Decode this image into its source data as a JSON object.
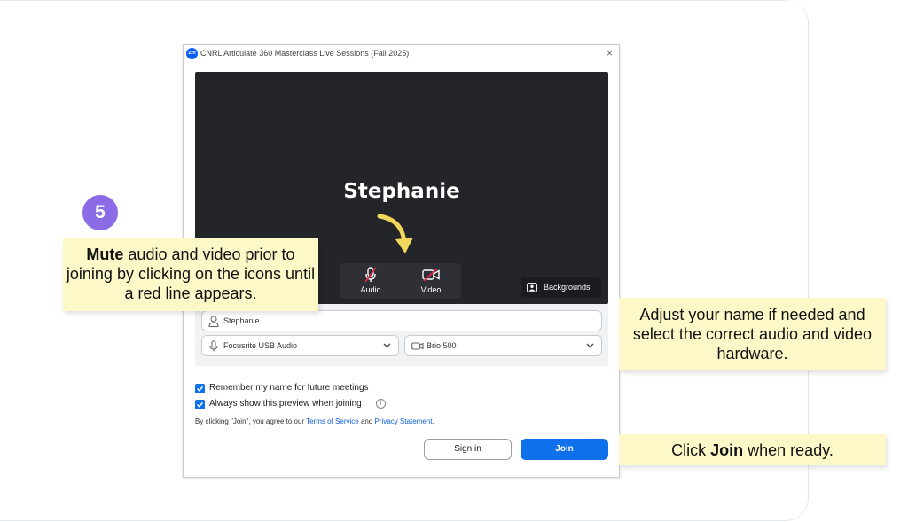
{
  "window": {
    "title": "CNRL Articulate 360 Masterclass Live Sessions (Fall 2025)",
    "logo": "zm",
    "close_glyph": "×"
  },
  "preview": {
    "participant_name": "Stephanie",
    "audio_label": "Audio",
    "video_label": "Video",
    "backgrounds_label": "Backgrounds"
  },
  "settings": {
    "name_value": "Stephanie",
    "audio_device": "Focusrite USB Audio",
    "video_device": "Brio 500"
  },
  "options": {
    "remember_name": "Remember my name for future meetings",
    "show_preview": "Always show this preview when joining",
    "remember_checked": true,
    "preview_checked": true,
    "info_glyph": "i"
  },
  "terms": {
    "prefix": "By clicking \"Join\", you agree to our ",
    "tos": "Terms of Service",
    "and": " and ",
    "privacy": "Privacy Statement",
    "suffix": "."
  },
  "buttons": {
    "sign_in": "Sign in",
    "join": "Join"
  },
  "annotations": {
    "step_number": "5",
    "mute_bold": "Mute",
    "mute_rest": " audio and video prior to joining by clicking on the icons until a red line appears.",
    "hardware": "Adjust your name if needed and select the correct audio and video hardware.",
    "join_pre": "Click ",
    "join_bold": "Join",
    "join_post": " when ready."
  },
  "colors": {
    "accent": "#0e71eb",
    "badge": "#8b6be6",
    "note_bg": "#fdf8c8",
    "mute_line": "#e0254a",
    "arrow": "#f2d85a"
  },
  "icons": [
    "person-icon",
    "microphone-muted-icon",
    "camera-muted-icon",
    "backgrounds-icon",
    "microphone-icon",
    "camera-icon",
    "chevron-down-icon",
    "checkmark-icon",
    "info-icon",
    "close-icon"
  ]
}
